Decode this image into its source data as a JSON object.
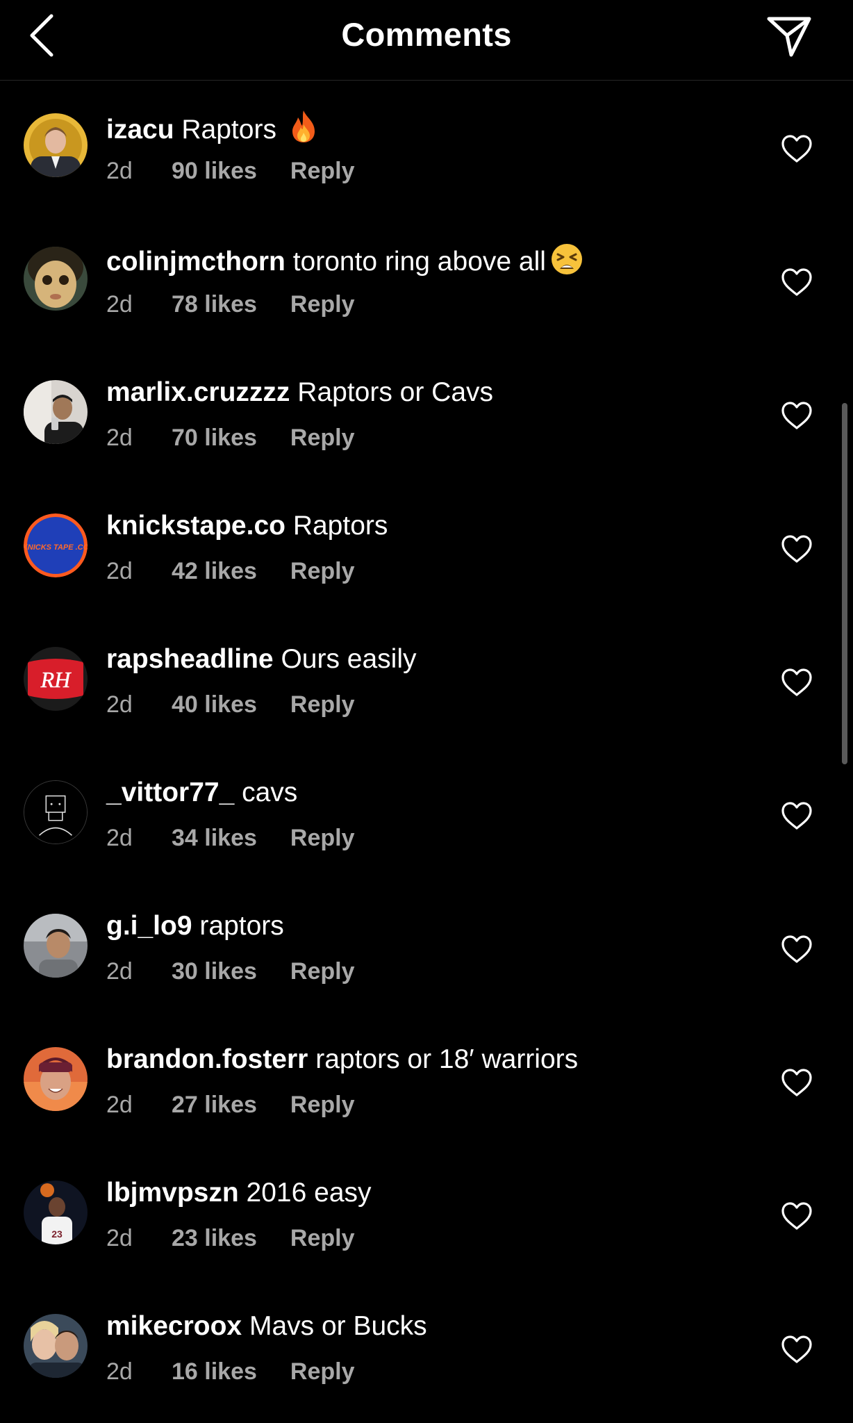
{
  "header": {
    "title": "Comments"
  },
  "comments": [
    {
      "username": "izacu",
      "text": "Raptors",
      "emoji": "fire",
      "time": "2d",
      "likes": "90 likes",
      "reply": "Reply"
    },
    {
      "username": "colinjmcthorn",
      "text": "toronto ring above all",
      "emoji": "tired-face",
      "time": "2d",
      "likes": "78 likes",
      "reply": "Reply"
    },
    {
      "username": "marlix.cruzzzz",
      "text": "Raptors or Cavs",
      "emoji": "",
      "time": "2d",
      "likes": "70 likes",
      "reply": "Reply"
    },
    {
      "username": "knickstape.co",
      "text": "Raptors",
      "emoji": "",
      "time": "2d",
      "likes": "42 likes",
      "reply": "Reply"
    },
    {
      "username": "rapsheadline",
      "text": "Ours easily",
      "emoji": "",
      "time": "2d",
      "likes": "40 likes",
      "reply": "Reply"
    },
    {
      "username": "_vittor77_",
      "text": "cavs",
      "emoji": "",
      "time": "2d",
      "likes": "34 likes",
      "reply": "Reply"
    },
    {
      "username": "g.i_lo9",
      "text": "raptors",
      "emoji": "",
      "time": "2d",
      "likes": "30 likes",
      "reply": "Reply"
    },
    {
      "username": "brandon.fosterr",
      "text": "raptors or 18′ warriors",
      "emoji": "",
      "time": "2d",
      "likes": "27 likes",
      "reply": "Reply"
    },
    {
      "username": "lbjmvpszn",
      "text": "2016 easy",
      "emoji": "",
      "time": "2d",
      "likes": "23 likes",
      "reply": "Reply"
    },
    {
      "username": "mikecroox",
      "text": "Mavs or Bucks",
      "emoji": "",
      "time": "2d",
      "likes": "16 likes",
      "reply": "Reply"
    }
  ],
  "avatar_logos": {
    "knickstape": "KNICKS TAPE .CO",
    "rapsheadline": "RH",
    "lbjmvpszn_jersey": "23"
  },
  "colors": {
    "background": "#000000",
    "text": "#ffffff",
    "secondary_text": "#a8a8a8",
    "divider": "#262626"
  }
}
